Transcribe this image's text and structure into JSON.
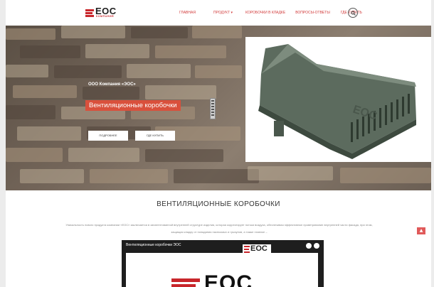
{
  "header": {
    "logo_text": "EOC",
    "logo_sub": "КОМПАНИЯ",
    "nav": [
      {
        "label": "ГЛАВНАЯ",
        "icon": ""
      },
      {
        "label": "ПРОДУКТ",
        "icon": "chevron-down-icon"
      },
      {
        "label": "КОРОБОЧКИ В КЛАДКЕ",
        "icon": ""
      },
      {
        "label": "ВОПРОСЫ-ОТВЕТЫ",
        "icon": ""
      },
      {
        "label": "ГДЕ КУПИТЬ",
        "icon": ""
      }
    ],
    "search_icon": "search-icon"
  },
  "hero": {
    "company": "ООО Компания «ЭОС»",
    "title": "Вентиляционные коробочки",
    "btn_more": "ПОДРОБНЕЕ",
    "btn_buy": "ГДЕ КУПИТЬ",
    "product_label": "EOC"
  },
  "main": {
    "section_title": "ВЕНТИЛЯЦИОННЫЕ КОРОБОЧКИ",
    "paragraph": "Уникальность нового продукта компании «ЕОС» заключается в запатентованной внутренней структуре изделия, которая корректирует потоки воздуха, обеспечивая эффективное проветривание внутренней части фасада, при этом, защищая кладку от попадания насекомых и грызунов, а также главное –",
    "video_title": "Вентиляционные коробочки ЭОС",
    "video_logo": "EOC"
  },
  "colors": {
    "accent": "#d9503c",
    "brand": "#c8262b"
  },
  "to_top_icon": "arrow-up-icon"
}
